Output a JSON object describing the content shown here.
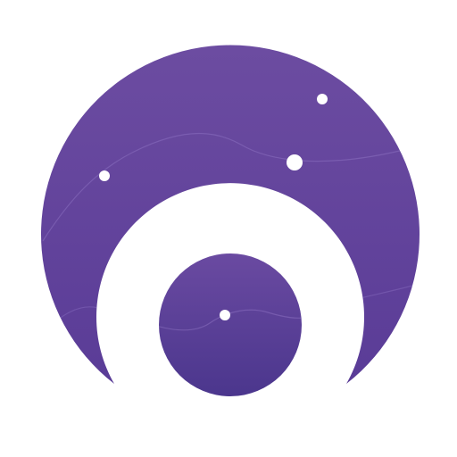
{
  "logo": {
    "icon": "planet-ring-logo-icon",
    "colors": {
      "background": "#ffffff",
      "outer_top": "#6c4ca1",
      "outer_bottom": "#5a3c97",
      "inner_top": "#6a4aa1",
      "inner_bottom": "#4b368d",
      "ring": "#ffffff",
      "star": "#ffffff",
      "orbit_line": "#8a6fc0"
    }
  }
}
